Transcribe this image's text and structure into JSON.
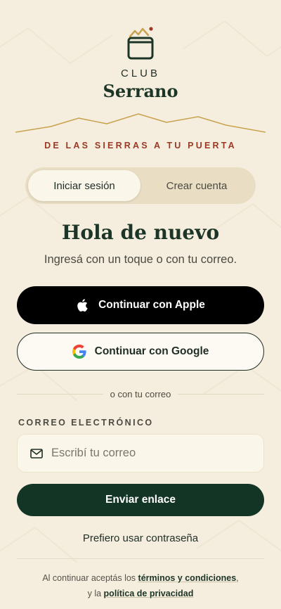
{
  "brand": {
    "club": "CLUB",
    "name": "Serrano",
    "tagline": "DE LAS SIERRAS A TU PUERTA",
    "logo_icon": "basket-mountain-icon"
  },
  "tabs": [
    {
      "label": "Iniciar sesión",
      "active": true
    },
    {
      "label": "Crear cuenta",
      "active": false
    }
  ],
  "heading": "Hola de nuevo",
  "subheading": "Ingresá con un toque o con tu correo.",
  "buttons": {
    "apple": {
      "label": "Continuar con Apple",
      "icon": "apple-icon"
    },
    "google": {
      "label": "Continuar con Google",
      "icon": "google-icon"
    },
    "send": {
      "label": "Enviar enlace"
    }
  },
  "divider": "o con tu correo",
  "email_field": {
    "label": "CORREO ELECTRÓNICO",
    "placeholder": "Escribí tu correo",
    "value": "",
    "icon": "mail-icon"
  },
  "alt_link": "Prefiero usar contraseña",
  "legal": {
    "prefix": "Al continuar aceptás los ",
    "terms": "términos y condiciones",
    "middle": ", y la ",
    "privacy": "política de privacidad"
  },
  "colors": {
    "background": "#f5eedf",
    "primary": "#133526",
    "accent": "#9a3a26",
    "gold": "#c9a24f"
  }
}
